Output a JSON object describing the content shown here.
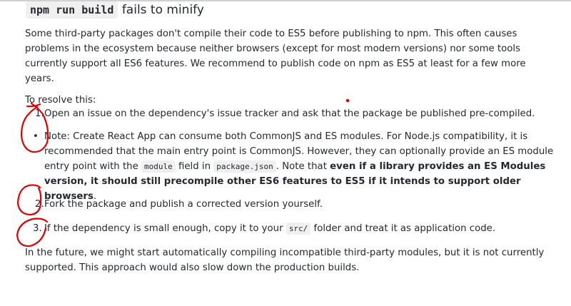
{
  "heading": {
    "code": "npm run build",
    "text": "fails to minify"
  },
  "intro": "Some third-party packages don't compile their code to ES5 before publishing to npm. This often causes problems in the ecosystem because neither browsers (except for most modern versions) nor some tools currently support all ES6 features. We recommend to publish code on npm as ES5 at least for a few more years.",
  "resolve_label": "To resolve this:",
  "items": [
    {
      "marker": "1.",
      "text": "Open an issue on the dependency's issue tracker and ask that the package be published pre-compiled."
    },
    {
      "marker": "•",
      "text_a": "Note: Create React App can consume both CommonJS and ES modules. For Node.js compatibility, it is recommended that the main entry point is CommonJS. However, they can optionally provide an ES module entry point with the ",
      "code1": "module",
      "text_b": " field in ",
      "code2": "package.json",
      "text_c": ". Note that ",
      "bold": "even if a library provides an ES Modules version, it should still precompile other ES6 features to ES5 if it intends to support older browsers",
      "text_d": "."
    },
    {
      "marker": "2.",
      "text": "Fork the package and publish a corrected version yourself."
    },
    {
      "marker": "3.",
      "text_a": "If the dependency is small enough, copy it to your ",
      "code": "src/",
      "text_b": " folder and treat it as application code."
    }
  ],
  "outro": "In the future, we might start automatically compiling incompatible third-party modules, but it is not currently supported. This approach would also slow down the production builds.",
  "annotation_color": "#e00000"
}
